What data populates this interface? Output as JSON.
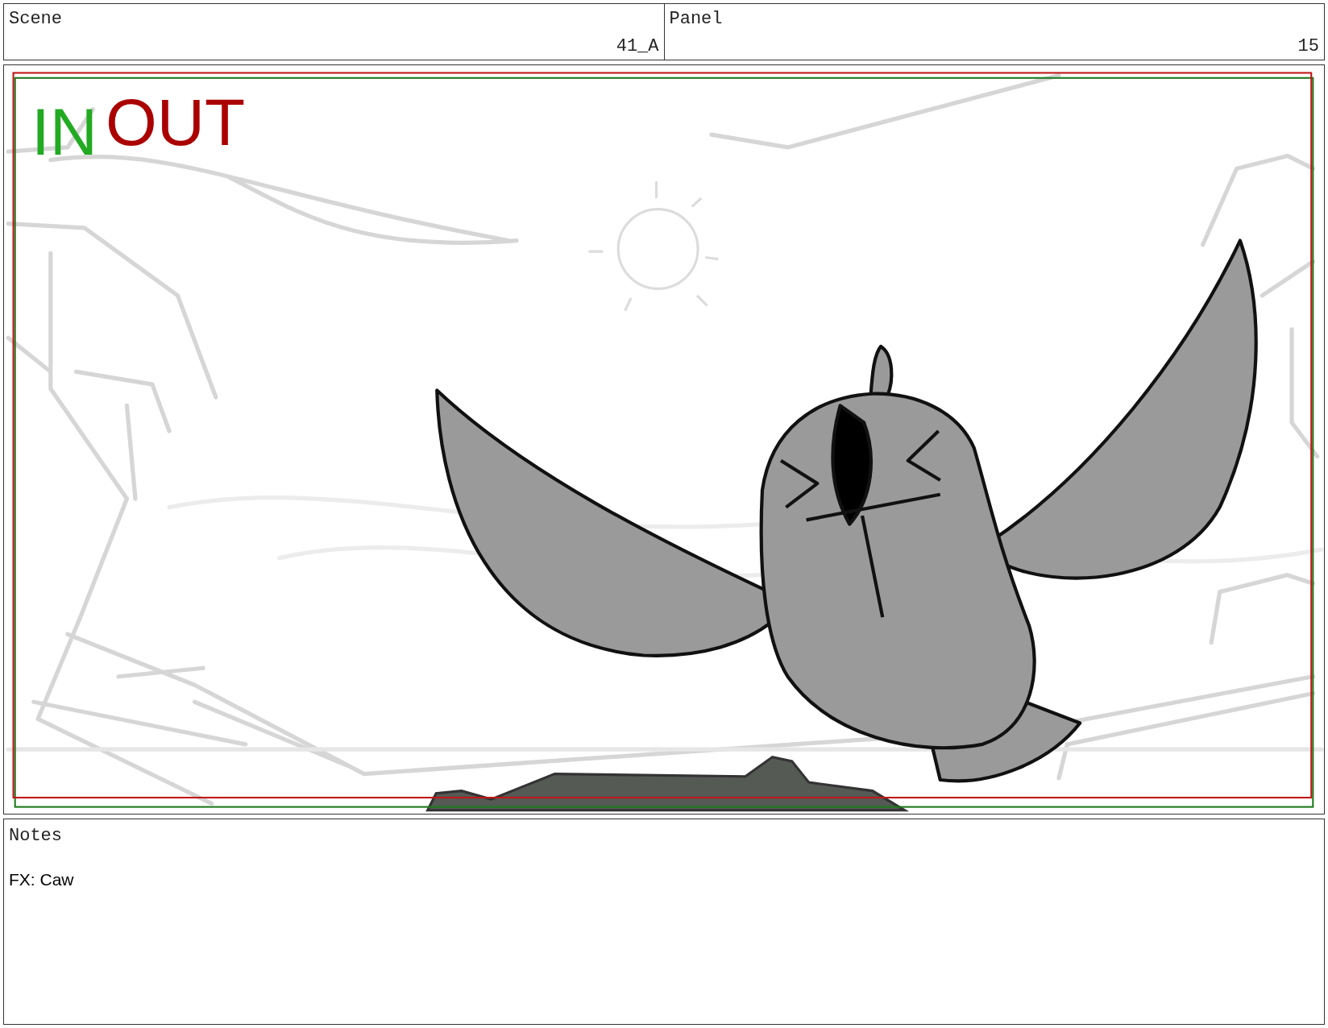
{
  "header": {
    "scene": {
      "label": "Scene",
      "value": "41_A"
    },
    "panel": {
      "label": "Panel",
      "value": "15"
    }
  },
  "frame": {
    "marks": [
      {
        "text": "IN",
        "color": "#22aa22"
      },
      {
        "text": "OUT",
        "color": "#aa0000"
      }
    ]
  },
  "notes": {
    "label": "Notes",
    "text": "FX: Caw"
  }
}
